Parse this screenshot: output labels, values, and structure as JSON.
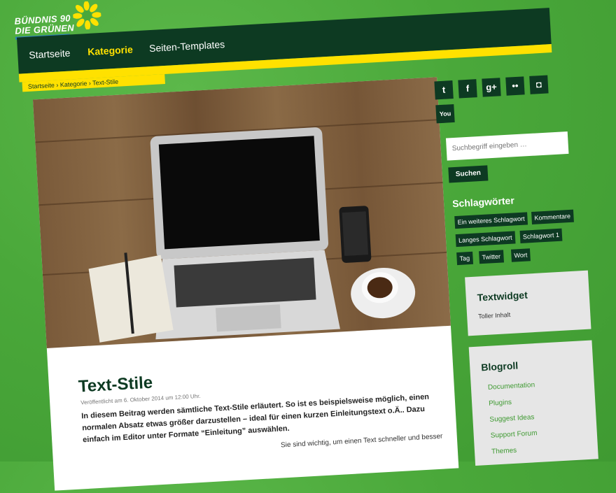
{
  "logo": {
    "line1": "BÜNDNIS 90",
    "line2": "DIE GRÜNEN"
  },
  "nav": {
    "items": [
      {
        "label": "Startseite"
      },
      {
        "label": "Kategorie"
      },
      {
        "label": "Seiten-Templates"
      }
    ]
  },
  "breadcrumb": {
    "text": "Startseite › Kategorie › Text-Stile"
  },
  "post": {
    "title": "Text-Stile",
    "meta": "Veröffentlicht am 6. Oktober 2014 um 12:00 Uhr.",
    "lead": "In diesem Beitrag werden sämtliche Text-Stile erläutert. So ist es beispielsweise möglich, einen normalen Absatz etwas größer darzustellen – ideal für einen kurzen Einleitungstext o.Ä.. Dazu einfach im Editor unter Formate “Einleitung” auswählen.",
    "body": "Sie sind wichtig, um einen Text schneller und besser"
  },
  "social": {
    "icons": [
      {
        "name": "twitter-icon",
        "glyph": "t"
      },
      {
        "name": "facebook-icon",
        "glyph": "f"
      },
      {
        "name": "googleplus-icon",
        "glyph": "g+"
      },
      {
        "name": "flickr-icon",
        "glyph": "••"
      },
      {
        "name": "instagram-icon",
        "glyph": "◘"
      },
      {
        "name": "youtube-icon",
        "glyph": "You"
      }
    ]
  },
  "search": {
    "placeholder": "Suchbegriff eingeben …",
    "button": "Suchen"
  },
  "tags": {
    "heading": "Schlagwörter",
    "items": [
      "Ein weiteres Schlagwort",
      "Kommentare",
      "Langes Schlagwort",
      "Schlagwort 1",
      "Tag",
      "Twitter",
      "Wort"
    ]
  },
  "textwidget": {
    "heading": "Textwidget",
    "content": "Toller Inhalt"
  },
  "blogroll": {
    "heading": "Blogroll",
    "links": [
      "Documentation",
      "Plugins",
      "Suggest Ideas",
      "Support Forum",
      "Themes"
    ]
  },
  "colors": {
    "green_bg": "#4aa83a",
    "dark_green": "#0d3a22",
    "yellow": "#ffe100"
  }
}
